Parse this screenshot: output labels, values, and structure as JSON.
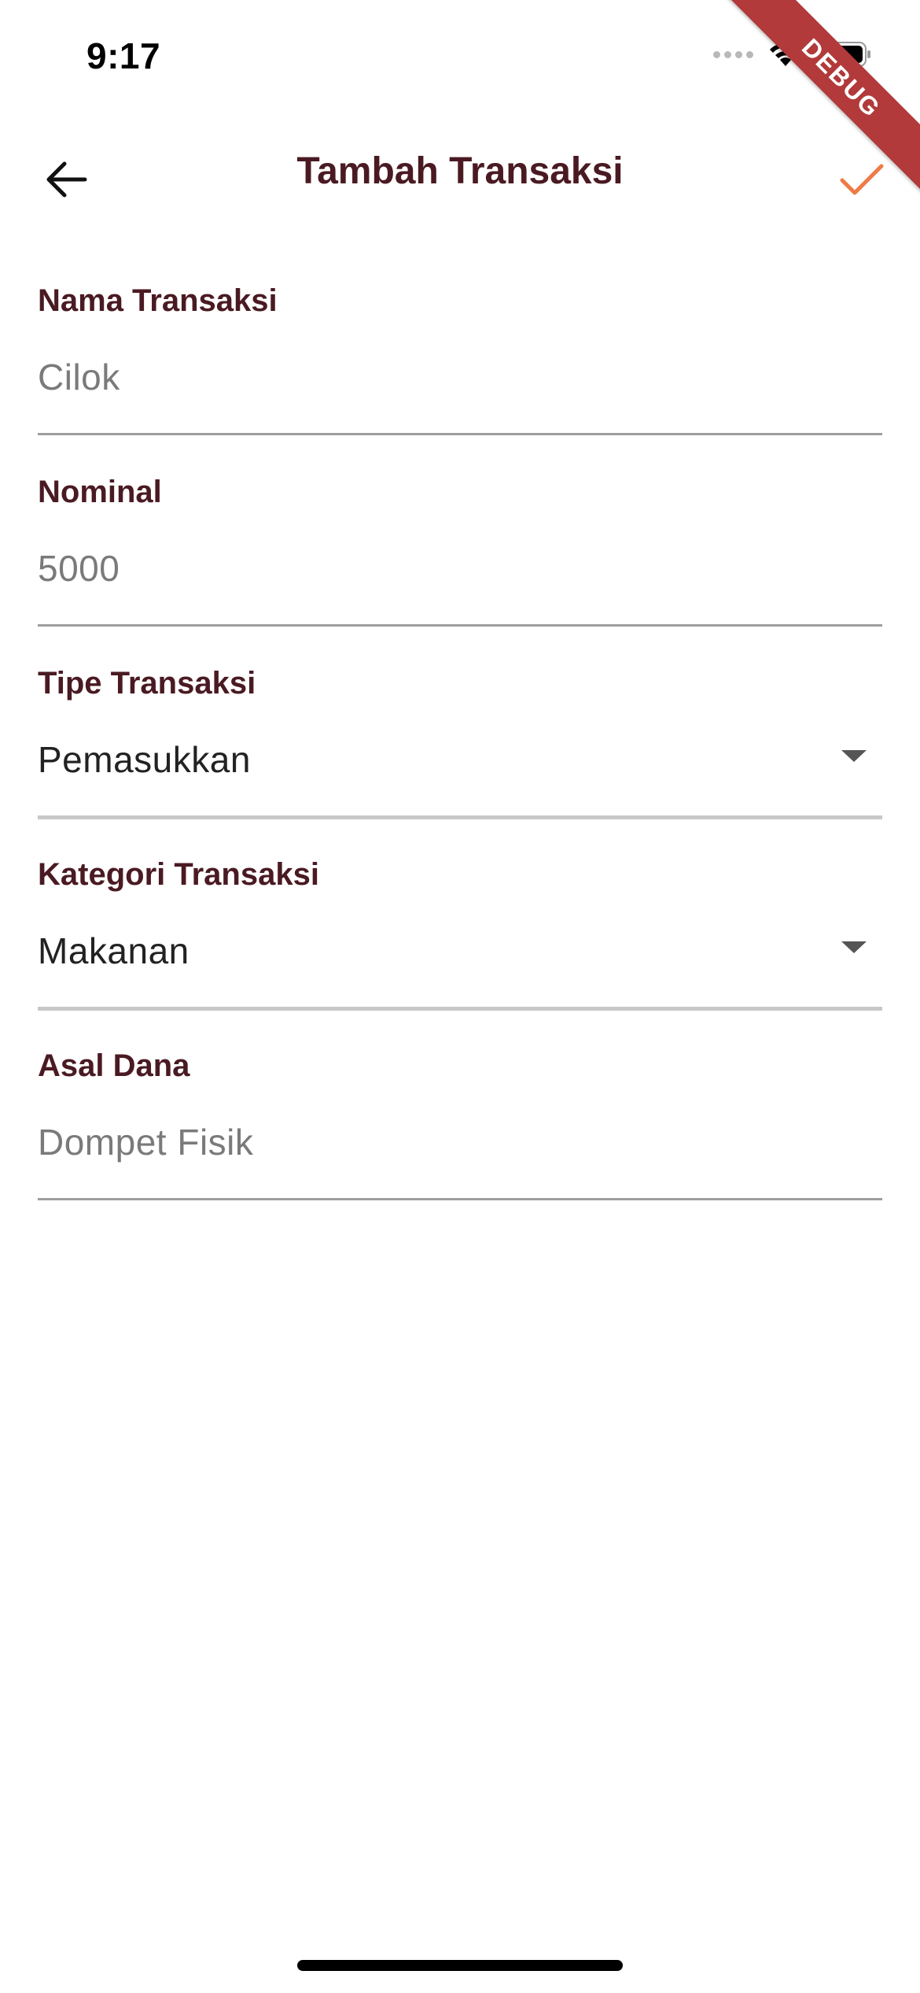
{
  "status_bar": {
    "time": "9:17"
  },
  "debug_banner": "DEBUG",
  "app_bar": {
    "title": "Tambah Transaksi",
    "back_icon": "arrow-back-icon",
    "confirm_icon": "check-icon",
    "confirm_color": "#f07a45"
  },
  "form": {
    "nama": {
      "label": "Nama Transaksi",
      "value": "Cilok"
    },
    "nominal": {
      "label": "Nominal",
      "value": "5000"
    },
    "tipe": {
      "label": "Tipe Transaksi",
      "value": "Pemasukkan"
    },
    "kategori": {
      "label": "Kategori Transaksi",
      "value": "Makanan"
    },
    "asal": {
      "label": "Asal Dana",
      "value": "Dompet Fisik"
    }
  },
  "colors": {
    "label": "#4a1a22",
    "accent": "#f07a45",
    "debug": "#b23a3a"
  }
}
